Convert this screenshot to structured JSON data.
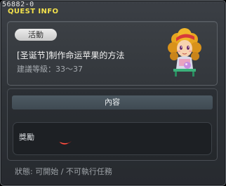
{
  "window": {
    "quest_id": "56882-0",
    "title": "QUEST INFO"
  },
  "info": {
    "category": "活動",
    "quest_name": "[圣诞节]制作命运苹果的方法",
    "level_label": "建議等級：",
    "level_range": "33～37",
    "npc_icon": "npc-girl-portrait"
  },
  "content": {
    "header": "內容",
    "reward_label": "獎勵",
    "reward_icon": "red-item-icon"
  },
  "status": {
    "text": "狀態: 可開始 / 不可執行任務"
  },
  "colors": {
    "title": "#f2e14c",
    "badge_bg": "#d9d9d9",
    "header_bg": "#46525a"
  }
}
